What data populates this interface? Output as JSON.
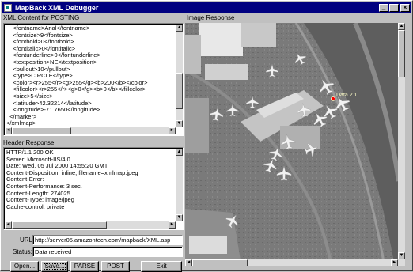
{
  "window": {
    "title": "MapBack XML Debugger",
    "min_glyph": "_",
    "max_glyph": "□",
    "close_glyph": "×"
  },
  "xml_panel": {
    "label": "XML Content for POSTING",
    "lines": [
      "    <fontname>Arial</fontname>",
      "    <fontsize>9</fontsize>",
      "    <fontbold>0</fontbold>",
      "    <fontitalic>0</fontitalic>",
      "    <fontunderline>0</fontunderline>",
      "    <textposition>NE</textposition>",
      "    <pullout>10</pullout>",
      "    <type>CIRCLE</type>",
      "    <color><r>255</r><g>255</g><b>200</b></color>",
      "    <fillcolor><r>255</r><g>0</g><b>0</b></fillcolor>",
      "    <size>5</size>",
      "    <latitude>42.32214</latitude>",
      "    <longitude>-71.7650</longitude>",
      "  </marker>",
      "</xmlmap>"
    ]
  },
  "header_panel": {
    "label": "Header Response",
    "lines": [
      "HTTP/1.1 200 OK",
      "Server: Microsoft-IIS/4.0",
      "Date: Wed, 05 Jul 2000 14:55:20 GMT",
      "Content-Disposition: inline; filename=xmlmap.jpeg",
      "Content-Error:",
      "Content-Performance: 3 sec.",
      "Content-Length: 274025",
      "Content-Type: image/jpeg",
      "Cache-control: private"
    ]
  },
  "url": {
    "label": "URL:",
    "value": "http://server05.amazontech.com/mapback/XML.asp"
  },
  "status": {
    "label": "Status:",
    "value": "Data received !"
  },
  "buttons": {
    "open": "Open...",
    "save": "Save...",
    "parse": "PARSE",
    "post": "POST",
    "exit": "Exit"
  },
  "image_panel": {
    "label": "Image Response",
    "marker_label": "Data 2.1",
    "marker_color": "#ff0000"
  },
  "scroll_glyphs": {
    "up": "▲",
    "down": "▼",
    "left": "◄",
    "right": "►"
  }
}
